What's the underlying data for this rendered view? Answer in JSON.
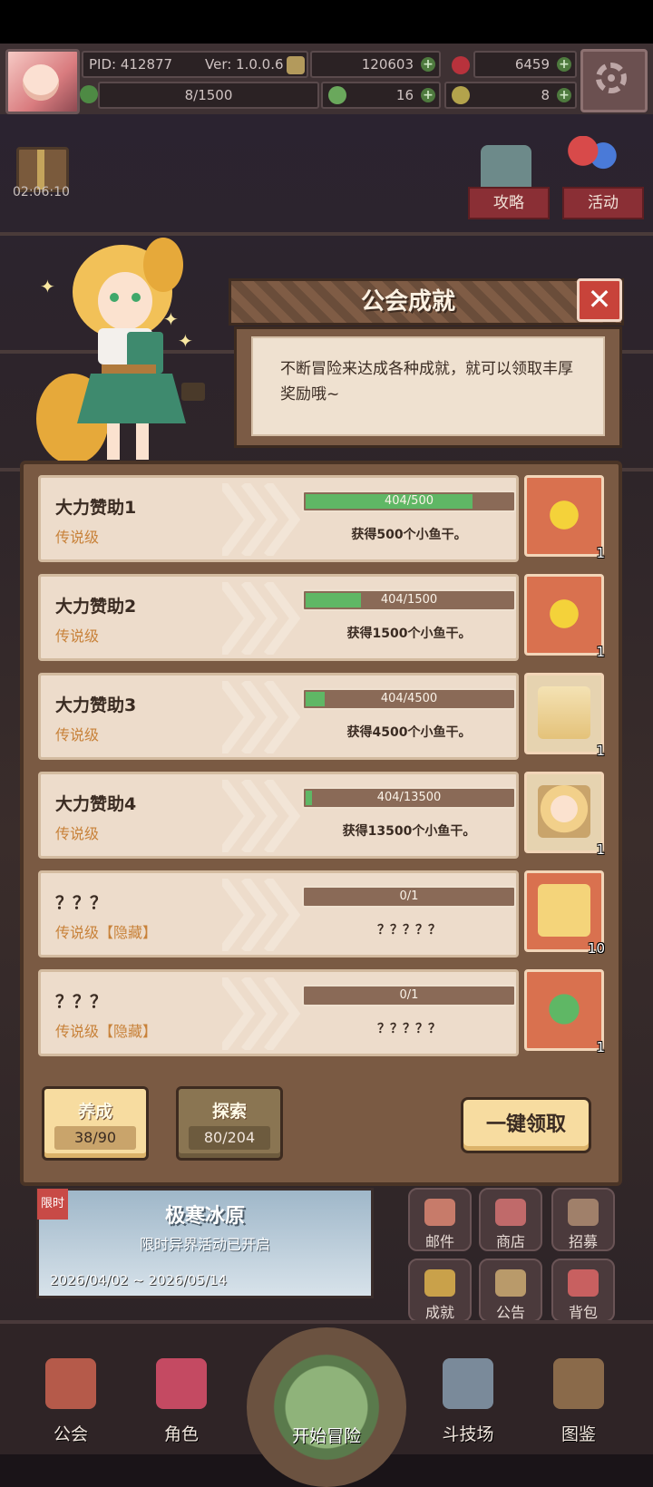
{
  "hud": {
    "pid": "PID: 412877",
    "version": "Ver: 1.0.0.6",
    "gold": "120603",
    "gems": "6459",
    "stamina": "8/1500",
    "clover": "16",
    "fish": "8"
  },
  "scene": {
    "timer": "02:06:10",
    "guide_label": "攻略",
    "activity_label": "活动"
  },
  "dialog": {
    "title": "公会成就",
    "close_symbol": "✕",
    "description": "不断冒险来达成各种成就，就可以领取丰厚奖励哦~"
  },
  "achievements": [
    {
      "name": "大力赞助1",
      "grade": "传说级",
      "progress_text": "404/500",
      "progress": 0.808,
      "reward": "获得500个小鱼干。",
      "icon": "star-icon",
      "qty": "1"
    },
    {
      "name": "大力赞助2",
      "grade": "传说级",
      "progress_text": "404/1500",
      "progress": 0.269,
      "reward": "获得1500个小鱼干。",
      "icon": "star-icon",
      "qty": "1"
    },
    {
      "name": "大力赞助3",
      "grade": "传说级",
      "progress_text": "404/4500",
      "progress": 0.09,
      "reward": "获得4500个小鱼干。",
      "icon": "frame-icon",
      "qty": "1"
    },
    {
      "name": "大力赞助4",
      "grade": "传说级",
      "progress_text": "404/13500",
      "progress": 0.03,
      "reward": "获得13500个小鱼干。",
      "icon": "portrait-icon",
      "qty": "1"
    },
    {
      "name": "？？？",
      "grade": "传说级【隐藏】",
      "progress_text": "0/1",
      "progress": 0,
      "reward": "？？？？？",
      "icon": "letter-icon",
      "qty": "10"
    },
    {
      "name": "？？？",
      "grade": "传说级【隐藏】",
      "progress_text": "0/1",
      "progress": 0,
      "reward": "？？？？？",
      "icon": "clover-icon",
      "qty": "1"
    }
  ],
  "footer": {
    "tab1_label": "养成",
    "tab1_count": "38/90",
    "tab2_label": "探索",
    "tab2_count": "80/204",
    "claim_all": "一键领取"
  },
  "event": {
    "tag": "限时",
    "name": "极寒冰原",
    "subtitle": "限时异界活动已开启",
    "dates": "2026/04/02 ~ 2026/05/14"
  },
  "grid": [
    "邮件",
    "商店",
    "招募",
    "成就",
    "公告",
    "背包"
  ],
  "nav": [
    "公会",
    "角色",
    "开始冒险",
    "斗技场",
    "图鉴"
  ],
  "colors": {
    "accent": "#5fb765",
    "panel": "#7a5a43",
    "card": "#eddccb",
    "grade": "#c8823a"
  }
}
